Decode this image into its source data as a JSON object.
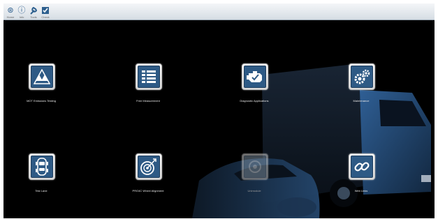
{
  "toolbar": {
    "buttons": [
      {
        "icon": "home-icon",
        "label": "Home"
      },
      {
        "icon": "info-icon",
        "label": "Info"
      },
      {
        "icon": "wrench-icon",
        "label": "Tools"
      },
      {
        "icon": "checkbox-icon",
        "label": "Check"
      }
    ]
  },
  "tiles": [
    {
      "label": "MOT Emissions Testing",
      "icon": "warning-triangles-icon",
      "enabled": true
    },
    {
      "label": "Free Measurement",
      "icon": "list-icon",
      "enabled": true
    },
    {
      "label": "Diagnostic Applications",
      "icon": "engine-icon",
      "enabled": true
    },
    {
      "label": "Maintenance",
      "icon": "gears-icon",
      "enabled": true
    },
    {
      "label": "Test Lane",
      "icon": "car-topview-icon",
      "enabled": true
    },
    {
      "label": "PRO4C Wheel Alignment",
      "icon": "wheel-alignment-icon",
      "enabled": true
    },
    {
      "label": "Unimodule",
      "icon": "unimodule-icon",
      "enabled": false
    },
    {
      "label": "Web Links",
      "icon": "link-icon",
      "enabled": true
    }
  ],
  "colors": {
    "tile_accent": "#2e5a85",
    "background": "#000000",
    "toolbar": "#e4e9ee"
  }
}
